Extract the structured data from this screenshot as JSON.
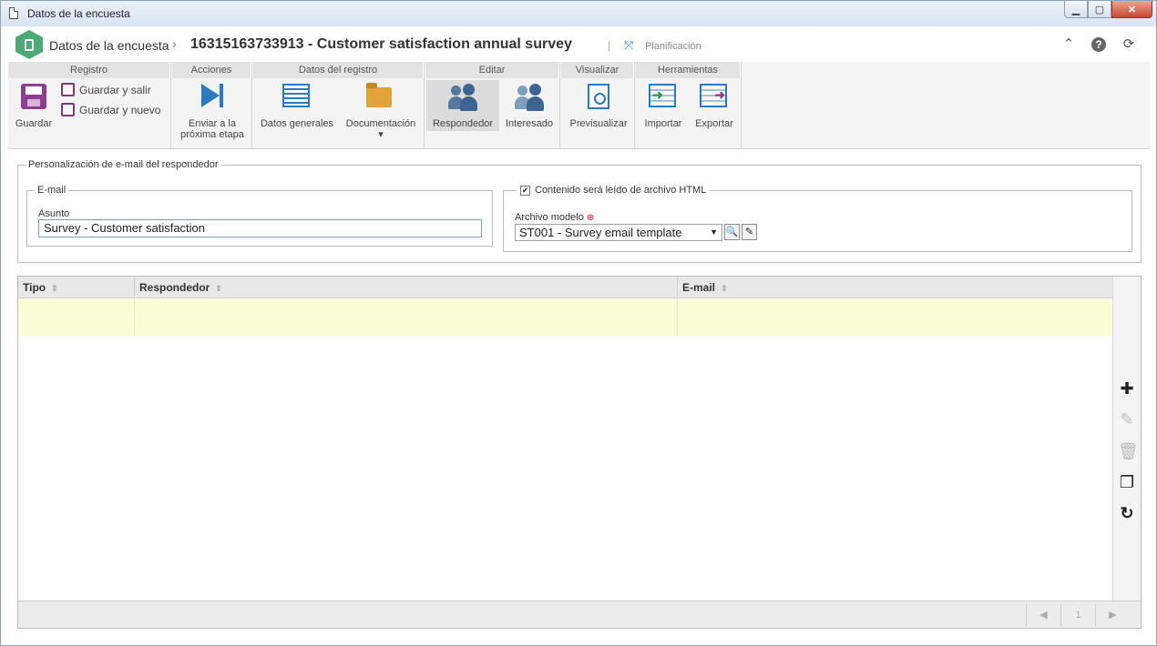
{
  "window": {
    "title": "Datos de la encuesta",
    "controls": {
      "minimize": "▁",
      "maximize": "▢",
      "close": "✕"
    }
  },
  "header": {
    "breadcrumb": "Datos de la encuesta",
    "separator": "›",
    "record_title": "16315163733913 - Customer satisfaction annual survey",
    "pipe": "|",
    "planning_label": "Planificación",
    "icons": {
      "collapse": "⌃",
      "help": "?",
      "refresh": "⟳"
    }
  },
  "ribbon": {
    "groups": {
      "registro": "Registro",
      "acciones": "Acciones",
      "datos_registro": "Datos del registro",
      "editar": "Editar",
      "visualizar": "Visualizar",
      "herramientas": "Herramientas"
    },
    "buttons": {
      "guardar": "Guardar",
      "guardar_salir": "Guardar y salir",
      "guardar_nuevo": "Guardar y nuevo",
      "enviar_line1": "Enviar a la",
      "enviar_line2": "próxima etapa",
      "datos_generales": "Datos generales",
      "documentacion": "Documentación",
      "documentacion_caret": "▾",
      "respondedor": "Respondedor",
      "interesado": "Interesado",
      "previsualizar": "Previsualizar",
      "importar": "Importar",
      "exportar": "Exportar"
    },
    "active_button": "Respondedor"
  },
  "form": {
    "section_title": "Personalización de e-mail del respondedor",
    "email_group": "E-mail",
    "subject_label": "Asunto",
    "subject_value": "Survey - Customer satisfaction",
    "html_checkbox_label": "Contenido será leído de archivo HTML",
    "html_checkbox_checked": true,
    "html_checkmark": "✔",
    "template_label": "Archivo modelo",
    "required_marker": "⊛",
    "template_value": "ST001 - Survey email template"
  },
  "grid": {
    "columns": [
      "Tipo",
      "Respondedor",
      "E-mail"
    ],
    "sort_glyph": "⇕",
    "tools": {
      "add": "✚",
      "edit": "✎",
      "delete": "🗑",
      "copy": "❐",
      "refresh": "↻"
    },
    "pager": {
      "prev": "◀",
      "page": "1",
      "next": "▶"
    }
  }
}
